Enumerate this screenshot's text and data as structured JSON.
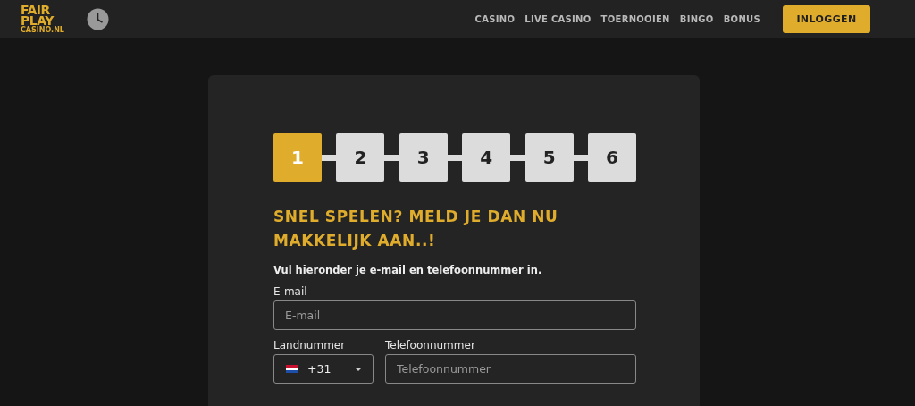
{
  "logo": {
    "lines": [
      "FAIR",
      "PLAY",
      "CASINO.NL"
    ]
  },
  "nav": {
    "items": [
      {
        "label": "CASINO"
      },
      {
        "label": "LIVE CASINO"
      },
      {
        "label": "TOERNOOIEN"
      },
      {
        "label": "BINGO"
      },
      {
        "label": "BONUS"
      }
    ],
    "login_button": "INLOGGEN"
  },
  "steps": [
    {
      "label": "1",
      "selected": true
    },
    {
      "label": "2",
      "selected": false
    },
    {
      "label": "3",
      "selected": false
    },
    {
      "label": "4",
      "selected": false
    },
    {
      "label": "5",
      "selected": false
    },
    {
      "label": "6",
      "selected": false
    }
  ],
  "form": {
    "title": "SNEL SPELEN? MELD JE DAN NU MAKKELIJK AAN..!",
    "intro": "Vul hieronder je e-mail en telefoonnummer in.",
    "email": {
      "label": "E-mail",
      "placeholder": "E-mail"
    },
    "country_code": {
      "label": "Landnummer",
      "value": "+31"
    },
    "phone": {
      "label": "Telefoonnummer",
      "placeholder": "Telefoonnummer"
    }
  }
}
